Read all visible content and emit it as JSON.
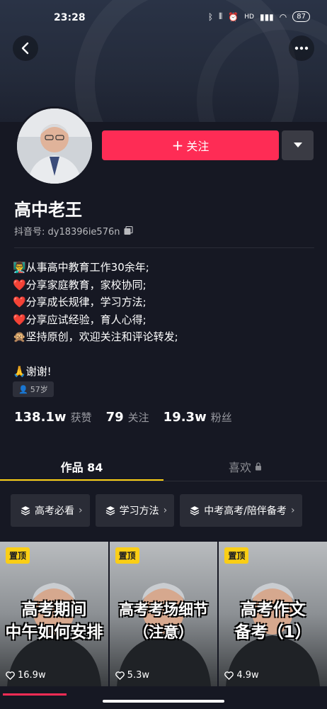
{
  "status_bar": {
    "time": "23:28",
    "network": "HD",
    "battery": "87"
  },
  "profile": {
    "name": "高中老王",
    "douyin_id": "抖音号: dy18396ie576n",
    "follow_label": "关注",
    "bio": [
      "👨‍🏫从事高中教育工作30余年;",
      "❤️分享家庭教育，家校协同;",
      "❤️分享成长规律，学习方法;",
      "❤️分享应试经验，育人心得;",
      "🙊坚持原创，欢迎关注和评论转发;",
      "",
      "🙏谢谢!"
    ],
    "age": "57岁"
  },
  "stats": {
    "likes": {
      "value": "138.1w",
      "label": "获赞"
    },
    "following": {
      "value": "79",
      "label": "关注"
    },
    "followers": {
      "value": "19.3w",
      "label": "粉丝"
    }
  },
  "tabs": {
    "works": "作品 84",
    "likes": "喜欢"
  },
  "collections": [
    "高考必看",
    "学习方法",
    "中考高考/陪伴备考"
  ],
  "videos": [
    {
      "pin": "置顶",
      "title_lines": [
        "高考期间",
        "中午如何安排"
      ],
      "likes": "16.9w"
    },
    {
      "pin": "置顶",
      "title_lines": [
        "高考考场细节",
        "（注意）"
      ],
      "likes": "5.3w"
    },
    {
      "pin": "置顶",
      "title_lines": [
        "高考作文",
        "备考（1）"
      ],
      "likes": "4.9w"
    }
  ],
  "colors": {
    "accent": "#fe2c55",
    "tab_underline": "#face15",
    "background": "#161823"
  }
}
